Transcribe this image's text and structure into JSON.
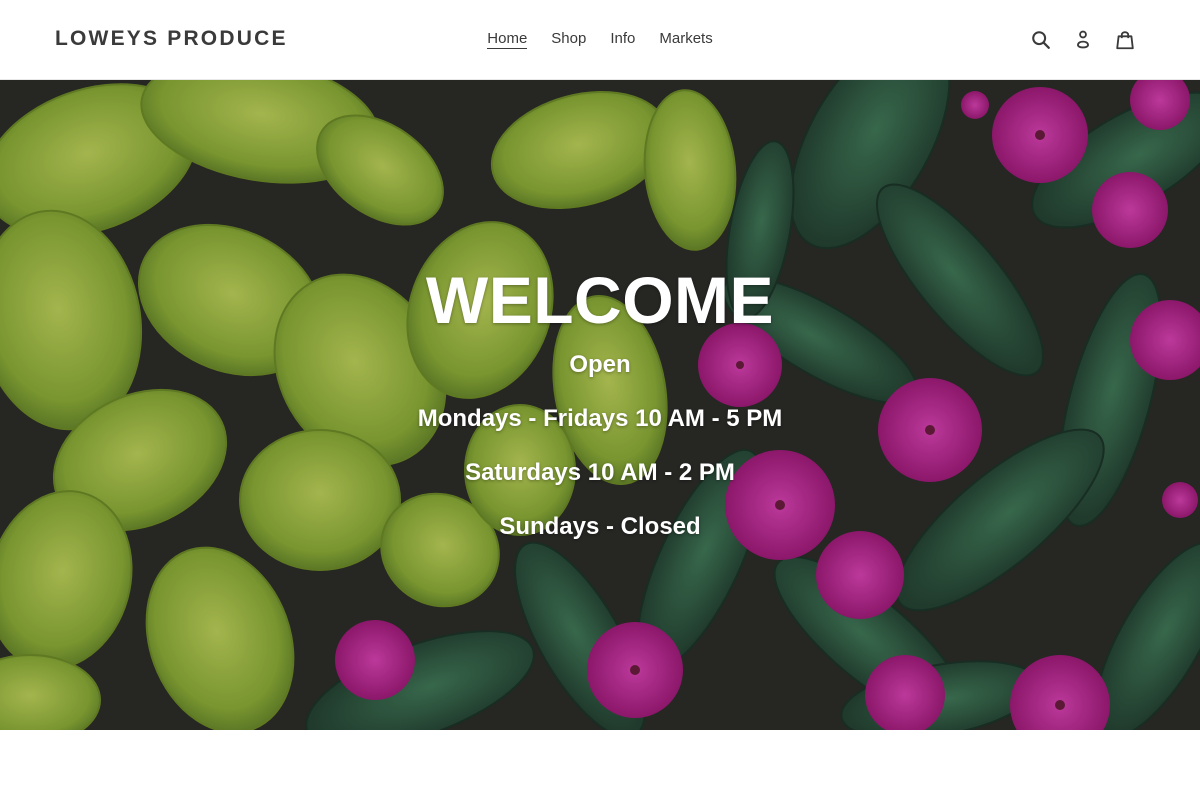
{
  "header": {
    "logo": "LOWEYS PRODUCE",
    "nav": [
      {
        "label": "Home",
        "active": true
      },
      {
        "label": "Shop"
      },
      {
        "label": "Info"
      },
      {
        "label": "Markets"
      }
    ],
    "icons": [
      "search-icon",
      "account-icon",
      "cart-icon"
    ]
  },
  "hero": {
    "title": "WELCOME",
    "lines": [
      "Open",
      "Mondays - Fridays 10 AM - 5 PM",
      "Saturdays 10 AM - 2 PM",
      "Sundays - Closed"
    ],
    "background": "green foliage with magenta flowers"
  },
  "colors": {
    "text": "#3a3a3a",
    "leaf_light": "#9dbb3a",
    "leaf_dark": "#2f5a3c",
    "flower": "#c2228f"
  }
}
